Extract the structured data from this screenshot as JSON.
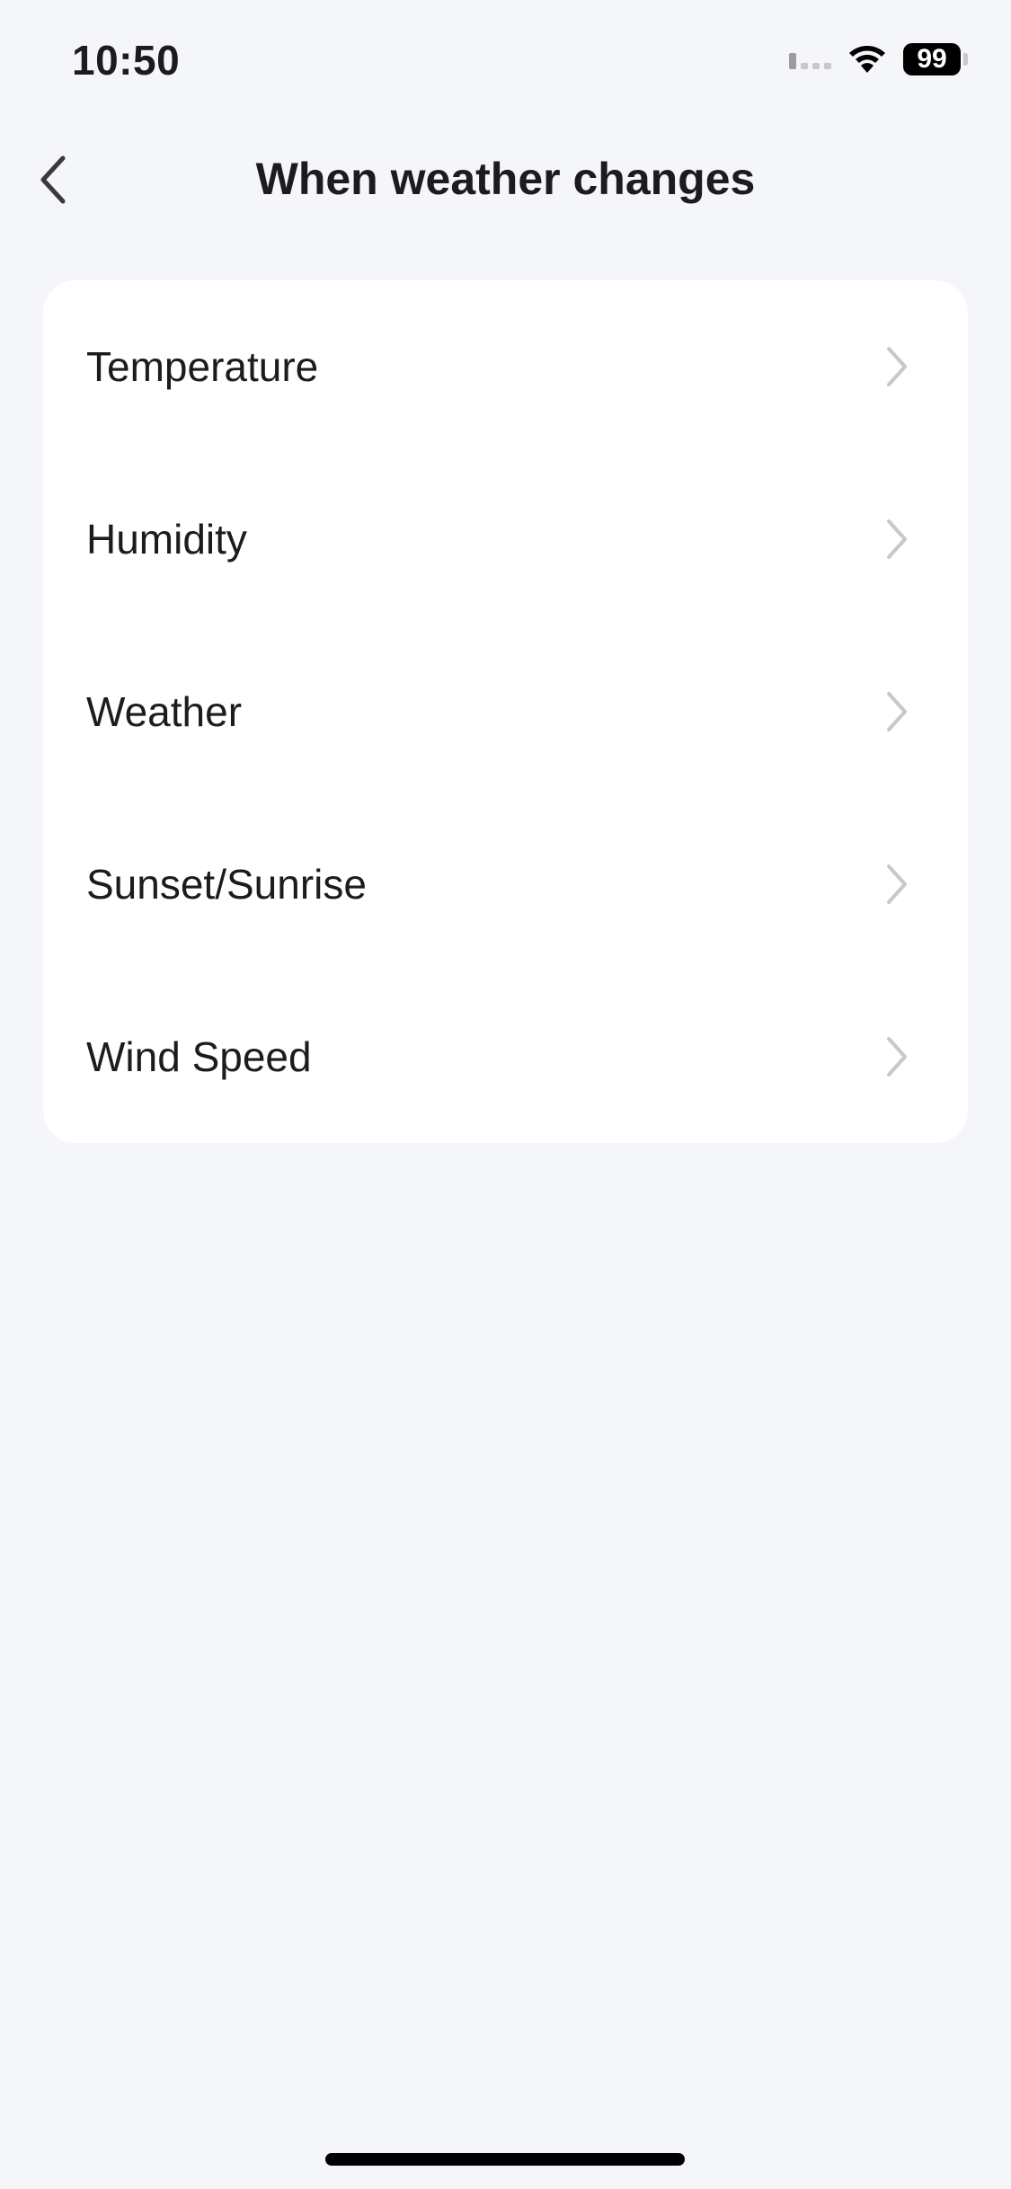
{
  "status_bar": {
    "time": "10:50",
    "battery": "99",
    "icons": [
      "cellular-signal-icon",
      "wifi-icon",
      "battery-icon"
    ]
  },
  "nav": {
    "title": "When weather changes",
    "back_icon": "chevron-left-icon"
  },
  "list": {
    "items": [
      {
        "label": "Temperature",
        "icon": "chevron-right-icon"
      },
      {
        "label": "Humidity",
        "icon": "chevron-right-icon"
      },
      {
        "label": "Weather",
        "icon": "chevron-right-icon"
      },
      {
        "label": "Sunset/Sunrise",
        "icon": "chevron-right-icon"
      },
      {
        "label": "Wind Speed",
        "icon": "chevron-right-icon"
      }
    ]
  },
  "colors": {
    "background": "#f5f6fa",
    "card": "#ffffff",
    "text": "#1c1c1e",
    "chevron": "#c7c7cc",
    "back_icon": "#3a3a3c"
  }
}
